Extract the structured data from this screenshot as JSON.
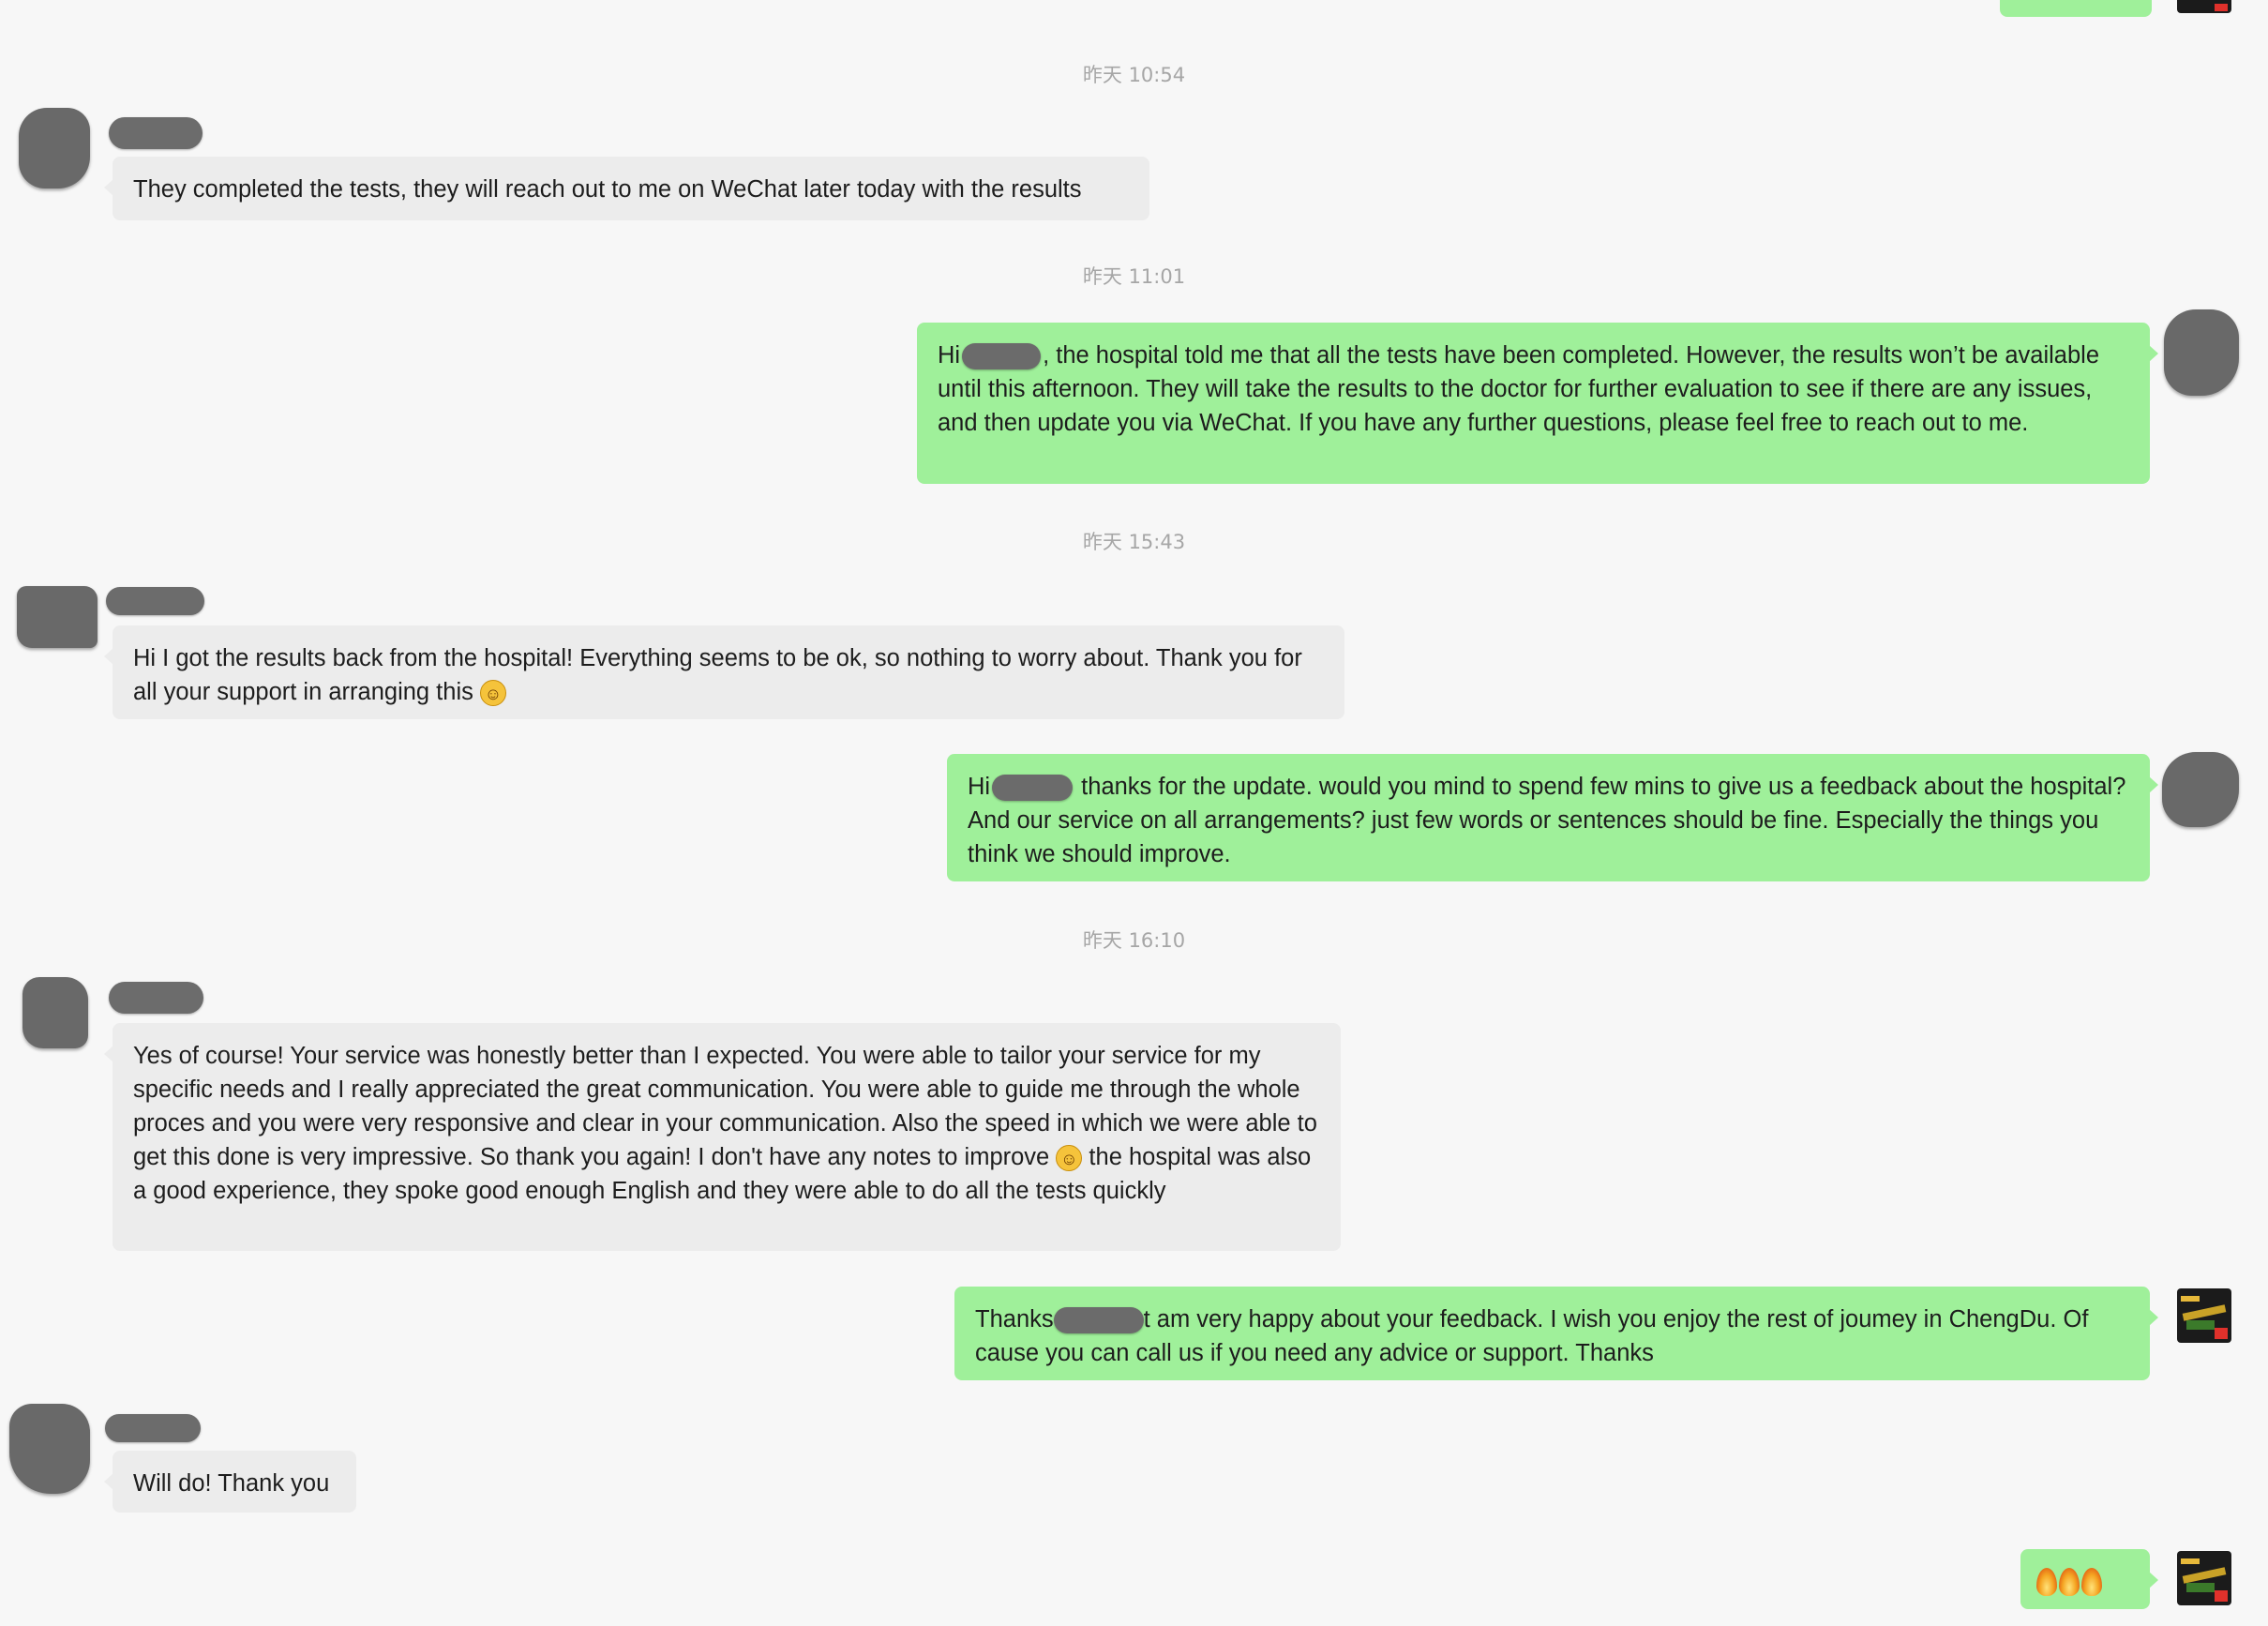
{
  "timestamps": {
    "t1": "昨天 10:54",
    "t2": "昨天 11:01",
    "t3": "昨天 15:43",
    "t4": "昨天 16:10"
  },
  "messages": {
    "m1": {
      "sender": "contact",
      "text": "They completed the tests, they will reach out to me on WeChat later today with the results"
    },
    "m2": {
      "sender": "me",
      "prefix": "Hi",
      "text": ", the hospital told me that all the tests have been completed. However, the results won’t be available until this afternoon. They will take the results to the doctor for further evaluation to see if there are any issues, and then update you via WeChat. If you have any further questions, please feel free to reach out to me."
    },
    "m3": {
      "sender": "contact",
      "text": "Hi I got the results back from the hospital! Everything seems to be ok, so nothing to worry about. Thank you for all your support in arranging this",
      "emoji": "smiling-face-emoji"
    },
    "m4": {
      "sender": "me",
      "prefix": "Hi",
      "text": " thanks for the update. would you mind to spend few mins to give us a feedback about the hospital? And our service on all arrangements? just few words or sentences should be fine. Especially the things you think we should improve."
    },
    "m5": {
      "sender": "contact",
      "text_a": "Yes of course! Your service was honestly better than I expected. You were able to tailor your service for my specific needs and I really appreciated the great communication. You were able to guide me through the whole proces and you were very responsive and clear in your communication. Also the speed in which we were able to get this done is very impressive. So thank you again! I don't have any notes to improve",
      "emoji": "smiling-face-emoji",
      "text_b": " the hospital was also a good experience, they spoke good enough English and they were able to do all the tests quickly"
    },
    "m6": {
      "sender": "me",
      "prefix": "Thanks",
      "text": "t am very happy about your feedback. I wish you enjoy the rest of joumey in ChengDu. Of cause you can call us if you need any advice or support. Thanks"
    },
    "m7": {
      "sender": "contact",
      "text": "Will do! Thank you"
    },
    "m8": {
      "sender": "me",
      "emojis": [
        "flame-emoji",
        "flame-emoji",
        "flame-emoji"
      ]
    }
  },
  "colors": {
    "background": "#f7f7f7",
    "incoming_bubble": "#ececec",
    "outgoing_bubble": "#9ff09a",
    "timestamp": "#a6a6a6",
    "redaction": "#6b6b6b"
  }
}
